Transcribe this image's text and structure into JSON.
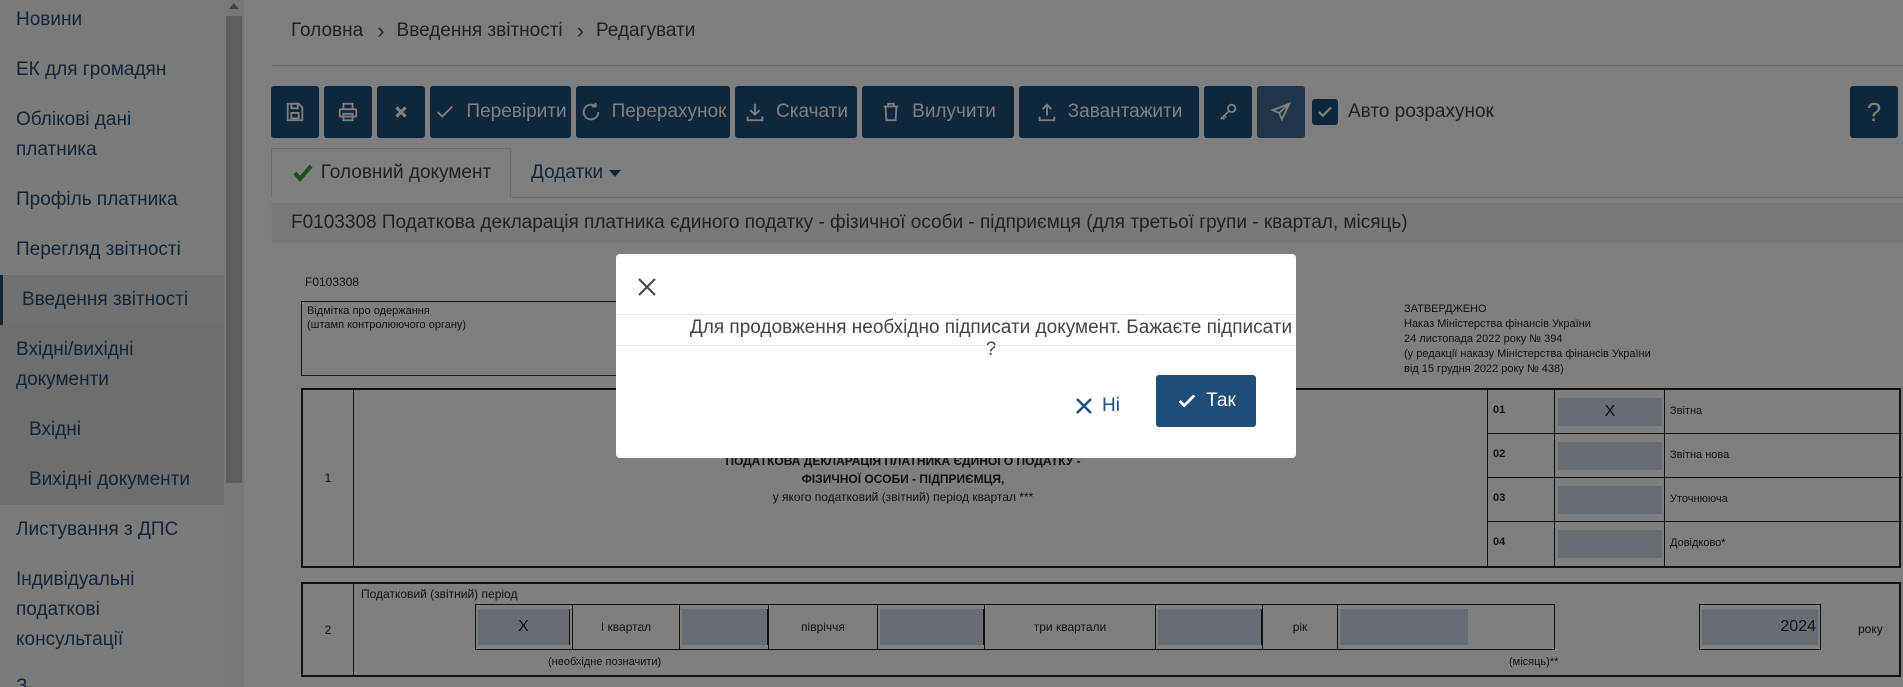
{
  "sidebar": {
    "items": [
      {
        "label": "Новини"
      },
      {
        "label": "ЕК для громадян"
      },
      {
        "label": "Облікові дані"
      },
      {
        "label": "платника"
      },
      {
        "label": "Профіль платника"
      },
      {
        "label": "Перегляд звітності"
      },
      {
        "label": "Введення звітності"
      },
      {
        "label": "Вхідні/вихідні"
      },
      {
        "label": "документи"
      },
      {
        "label": "Вхідні"
      },
      {
        "label": "Вихідні документи"
      },
      {
        "label": "Листування з ДПС"
      },
      {
        "label": "Індивідуальні"
      },
      {
        "label": "податкові"
      },
      {
        "label": "консультації"
      },
      {
        "label": "З..."
      }
    ]
  },
  "breadcrumb": {
    "items": [
      "Головна",
      "Введення звітності",
      "Редагувати"
    ]
  },
  "toolbar": {
    "check_label": "Перевірити",
    "recalc_label": "Перерахунок",
    "download_label": "Скачати",
    "delete_label": "Вилучити",
    "upload_label": "Завантажити",
    "auto_calc_label": "Авто розрахунок",
    "help_label": "?"
  },
  "tabs": {
    "main_doc": "Головний документ",
    "attachments": "Додатки"
  },
  "document": {
    "title": "F0103308 Податкова декларація платника єдиного податку - фізичної особи - підприємця (для третьої групи - квартал, місяць)"
  },
  "form": {
    "code": "F0103308",
    "stamp_line1": "Відмітка про одержання",
    "stamp_line2": "(штамп контролюючого органу)",
    "approved_line1": "ЗАТВЕРДЖЕНО",
    "approved_line2": "Наказ Міністерства фінансів України",
    "approved_line3": "24 листопада 2022 року № 394",
    "approved_line4": "(у редакції наказу Міністерства фінансів України",
    "approved_line5": "від 15 грудня 2022 року № 438)",
    "section1_num": "1",
    "decl_line1": "ПОДАТКОВА ДЕКЛАРАЦІЯ ПЛАТНИКА ЄДИНОГО ПОДАТКУ -",
    "decl_line2": "ФІЗИЧНОЇ ОСОБИ - ПІДПРИЄМЦЯ,",
    "decl_line3": "у якого податковий (звітний) період квартал ***",
    "rows": [
      {
        "code": "01",
        "value": "X",
        "label": "Звітна"
      },
      {
        "code": "02",
        "value": "",
        "label": "Звітна нова"
      },
      {
        "code": "03",
        "value": "",
        "label": "Уточнююча"
      },
      {
        "code": "04",
        "value": "",
        "label": "Довідково*"
      }
    ],
    "section2_num": "2",
    "period_header": "Податковий (звітний) період",
    "period_q1_mark": "X",
    "period_q1": "I квартал",
    "period_half": "півріччя",
    "period_three": "три квартали",
    "period_year": "рік",
    "year_value": "2024",
    "roku": "року",
    "note_mark": "(необхідне позначити)",
    "note_month": "(місяць)**"
  },
  "modal": {
    "message": "Для продовження необхідно підписати документ. Бажаєте підписати ?",
    "no_label": "Ні",
    "yes_label": "Так"
  }
}
